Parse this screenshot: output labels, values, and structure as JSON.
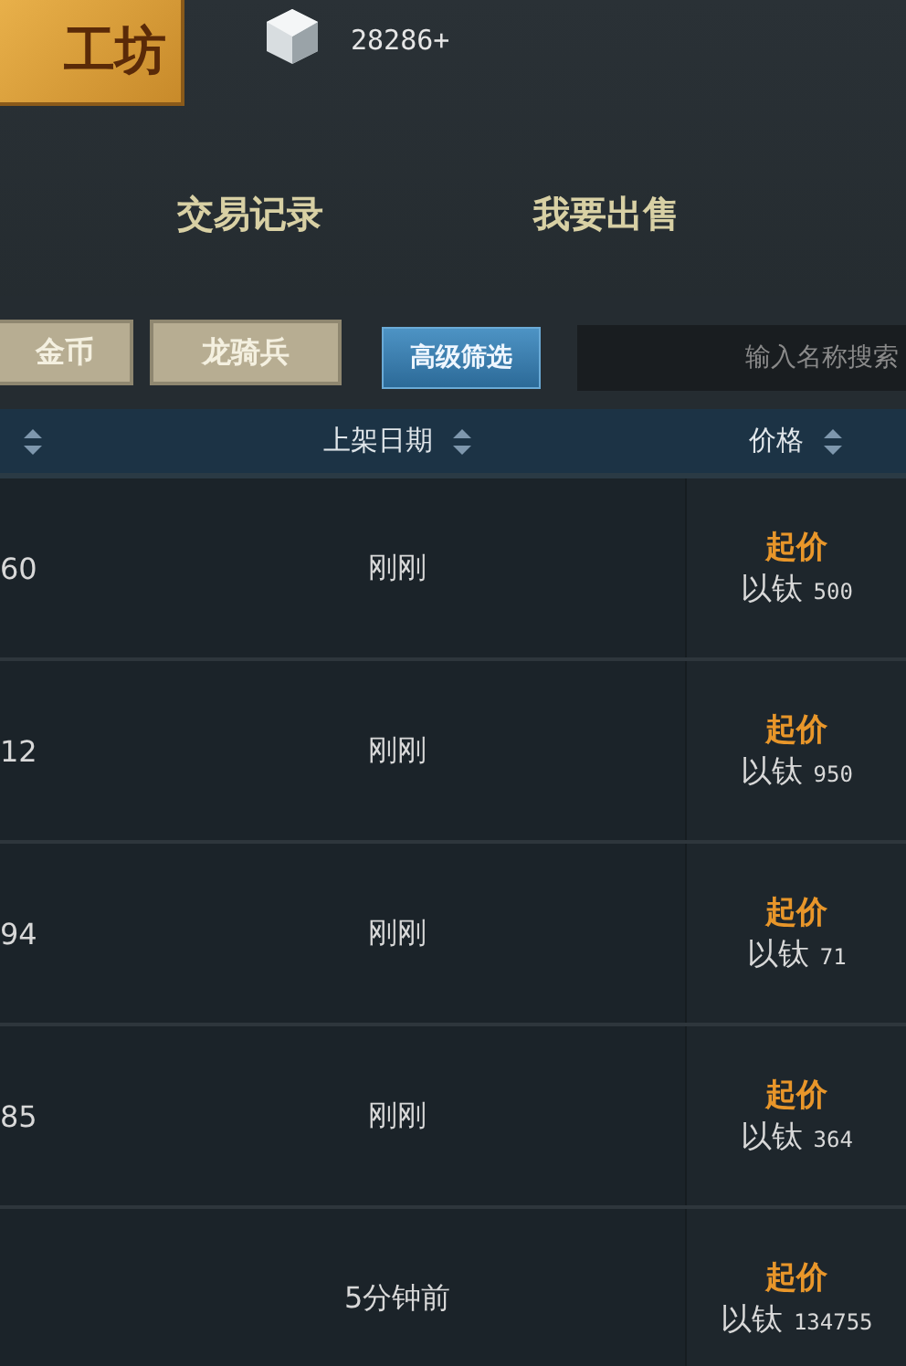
{
  "header": {
    "title": "工坊",
    "currency": "28286+"
  },
  "tabs": [
    {
      "label": "交易记录"
    },
    {
      "label": "我要出售"
    }
  ],
  "filters": [
    "金币",
    "龙骑兵"
  ],
  "advanced_button": "高级筛选",
  "search": {
    "placeholder": "输入名称搜索"
  },
  "table": {
    "columns": [
      {
        "sortable": true
      },
      {
        "label": "上架日期",
        "sortable": true
      },
      {
        "label": "价格",
        "sortable": true
      }
    ],
    "rows": [
      {
        "column_1": "60",
        "date": "刚刚",
        "price_label": "起价",
        "price": "以钛",
        "amount": "500"
      },
      {
        "column_1": "12",
        "date": "刚刚",
        "price_label": "起价",
        "price": "以钛",
        "amount": "950"
      },
      {
        "column_1": "94",
        "date": "刚刚",
        "price_label": "起价",
        "price": "以钛",
        "amount": "71"
      },
      {
        "column_1": "85",
        "date": "刚刚",
        "price_label": "起价",
        "price": "以钛",
        "amount": "364"
      },
      {
        "date": "5分钟前",
        "price_label": "起价",
        "price": "以钛",
        "amount": "134755"
      }
    ]
  }
}
